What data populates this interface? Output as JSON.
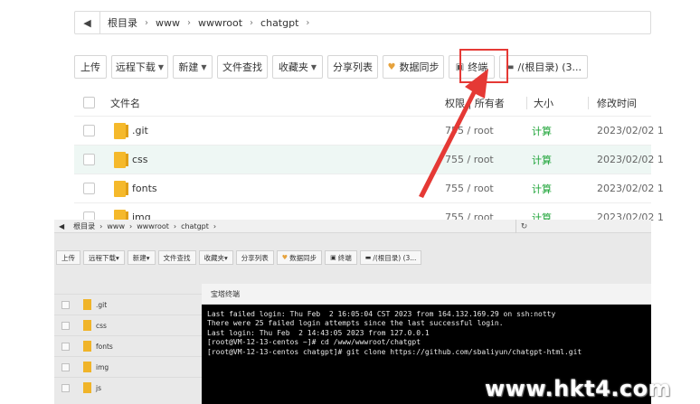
{
  "top": {
    "breadcrumb": {
      "back_icon": "arrow-left-icon",
      "segments": [
        "根目录",
        "www",
        "wwwroot",
        "chatgpt"
      ]
    },
    "toolbar": {
      "upload": "上传",
      "remote_download": "远程下载",
      "new": "新建",
      "file_search": "文件查找",
      "favorites": "收藏夹",
      "share_list": "分享列表",
      "data_sync": "数据同步",
      "terminal": "终端",
      "disk": "/(根目录) (3..."
    },
    "table": {
      "headers": {
        "name": "文件名",
        "perm_owner": "权限 | 所有者",
        "size": "大小",
        "mtime": "修改时间"
      },
      "rows": [
        {
          "name": ".git",
          "perm": "755 / root",
          "size": "计算",
          "mtime": "2023/02/02 1"
        },
        {
          "name": "css",
          "perm": "755 / root",
          "size": "计算",
          "mtime": "2023/02/02 1"
        },
        {
          "name": "fonts",
          "perm": "755 / root",
          "size": "计算",
          "mtime": "2023/02/02 1"
        },
        {
          "name": "img",
          "perm": "755 / root",
          "size": "计算",
          "mtime": "2023/02/02 1"
        }
      ]
    },
    "highlight_color": "#e53935"
  },
  "bottom": {
    "breadcrumb": {
      "segments": [
        "根目录",
        "www",
        "wwwroot",
        "chatgpt"
      ],
      "refresh_icon": "refresh-icon"
    },
    "toolbar": {
      "upload": "上传",
      "remote_download": "远程下载",
      "new": "新建",
      "file_search": "文件查找",
      "favorites": "收藏夹",
      "share_list": "分享列表",
      "data_sync": "数据同步",
      "terminal": "终端",
      "disk": "/(根目录) (3..."
    },
    "rows": [
      ".git",
      "css",
      "fonts",
      "img",
      "js"
    ],
    "terminal": {
      "title": "宝塔终端",
      "lines": [
        "Last failed login: Thu Feb  2 16:05:04 CST 2023 from 164.132.169.29 on ssh:notty",
        "There were 25 failed login attempts since the last successful login.",
        "Last login: Thu Feb  2 14:43:05 2023 from 127.0.0.1",
        "[root@VM-12-13-centos ~]# cd /www/wwwroot/chatgpt",
        "[root@VM-12-13-centos chatgpt]# git clone https://github.com/sbaliyun/chatgpt-html.git"
      ]
    }
  },
  "watermark": "www.hkt4.com"
}
